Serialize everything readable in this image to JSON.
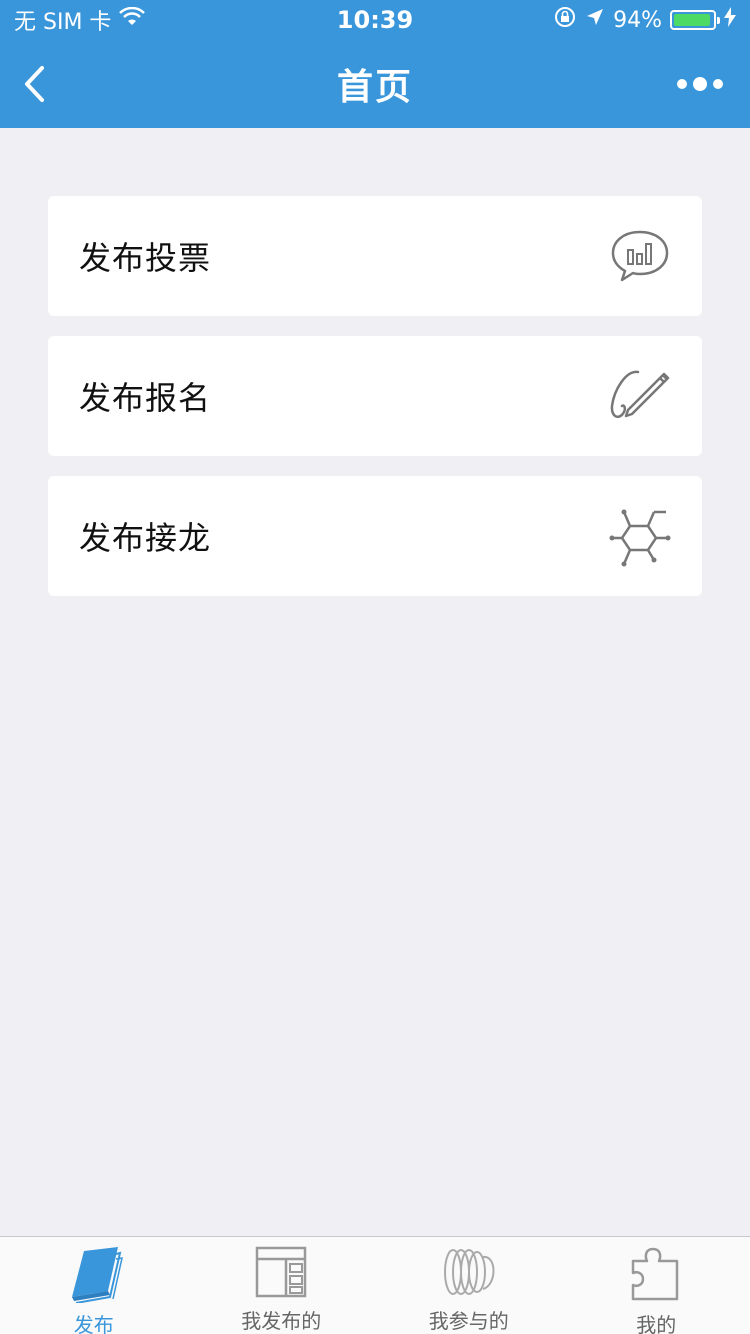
{
  "status_bar": {
    "carrier": "无 SIM 卡",
    "time": "10:39",
    "battery": "94%",
    "battery_level": 0.94
  },
  "nav": {
    "title": "首页"
  },
  "cards": [
    {
      "label": "发布投票",
      "icon": "chart-bubble-icon"
    },
    {
      "label": "发布报名",
      "icon": "pencil-signature-icon"
    },
    {
      "label": "发布接龙",
      "icon": "hexagon-network-icon"
    }
  ],
  "tabs": [
    {
      "label": "发布",
      "icon": "book-icon",
      "active": true
    },
    {
      "label": "我发布的",
      "icon": "layout-icon",
      "active": false
    },
    {
      "label": "我参与的",
      "icon": "rings-icon",
      "active": false
    },
    {
      "label": "我的",
      "icon": "puzzle-icon",
      "active": false
    }
  ],
  "colors": {
    "primary": "#3a96db",
    "background": "#efeff4",
    "icon_gray": "#777777",
    "tab_inactive": "#999999"
  }
}
